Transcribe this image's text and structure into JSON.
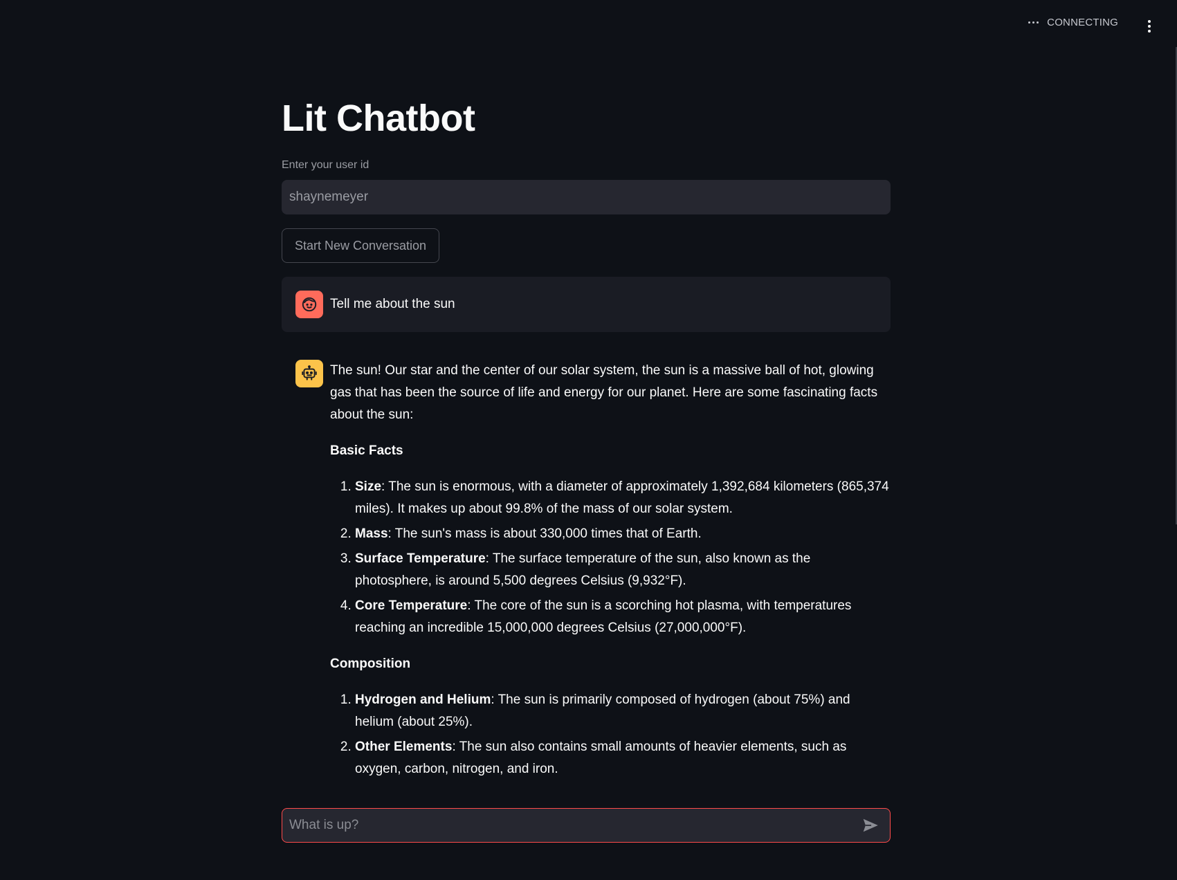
{
  "status": {
    "text": "CONNECTING"
  },
  "page": {
    "title": "Lit Chatbot"
  },
  "user_id_field": {
    "label": "Enter your user id",
    "value": "shaynemeyer"
  },
  "buttons": {
    "new_conversation": "Start New Conversation"
  },
  "messages": {
    "user": {
      "text": "Tell me about the sun"
    },
    "assistant": {
      "intro": "The sun! Our star and the center of our solar system, the sun is a massive ball of hot, glowing gas that has been the source of life and energy for our planet. Here are some fascinating facts about the sun:",
      "sections": [
        {
          "heading": "Basic Facts",
          "items": [
            {
              "term": "Size",
              "text": ": The sun is enormous, with a diameter of approximately 1,392,684 kilometers (865,374 miles). It makes up about 99.8% of the mass of our solar system."
            },
            {
              "term": "Mass",
              "text": ": The sun's mass is about 330,000 times that of Earth."
            },
            {
              "term": "Surface Temperature",
              "text": ": The surface temperature of the sun, also known as the photosphere, is around 5,500 degrees Celsius (9,932°F)."
            },
            {
              "term": "Core Temperature",
              "text": ": The core of the sun is a scorching hot plasma, with temperatures reaching an incredible 15,000,000 degrees Celsius (27,000,000°F)."
            }
          ]
        },
        {
          "heading": "Composition",
          "items": [
            {
              "term": "Hydrogen and Helium",
              "text": ": The sun is primarily composed of hydrogen (about 75%) and helium (about 25%)."
            },
            {
              "term": "Other Elements",
              "text": ": The sun also contains small amounts of heavier elements, such as oxygen, carbon, nitrogen, and iron."
            }
          ]
        }
      ]
    }
  },
  "chat_input": {
    "placeholder": "What is up?"
  },
  "icons": {
    "user_avatar": "user-face-icon",
    "assistant_avatar": "robot-icon",
    "send": "send-arrow-icon",
    "menu": "kebab-menu-icon",
    "status": "ellipsis-icon"
  },
  "colors": {
    "background": "#0e1117",
    "user_avatar": "#ff6b5b",
    "assistant_avatar": "#fcc34a",
    "accent": "#ff4b4b"
  }
}
